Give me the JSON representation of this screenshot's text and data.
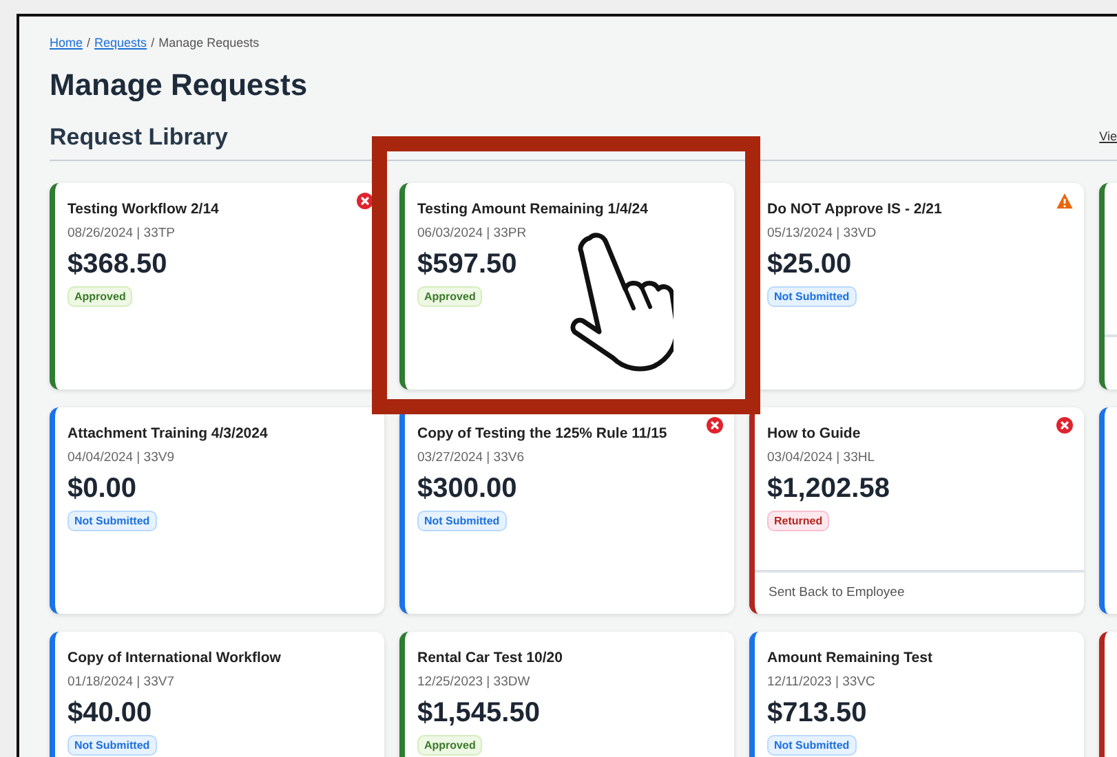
{
  "breadcrumb": {
    "separator": "/",
    "items": [
      {
        "label": "Home",
        "link": true
      },
      {
        "label": "Requests",
        "link": true
      },
      {
        "label": "Manage Requests",
        "link": false
      }
    ]
  },
  "title": "Manage Requests",
  "section": {
    "title": "Request Library",
    "action": "Vie"
  },
  "cards": [
    {
      "kind": "card",
      "title": "Testing Workflow 2/14",
      "meta": "08/26/2024 | 33TP",
      "amount": "$368.50",
      "status": {
        "label": "Approved",
        "kind": "approved"
      },
      "alert": {
        "kind": "error"
      }
    },
    {
      "kind": "card",
      "title": "Testing Amount Remaining 1/4/24",
      "meta": "06/03/2024 | 33PR",
      "amount": "$597.50",
      "status": {
        "label": "Approved",
        "kind": "approved"
      }
    },
    {
      "kind": "card",
      "title": "Do NOT Approve IS - 2/21",
      "meta": "05/13/2024 | 33VD",
      "amount": "$25.00",
      "status": {
        "label": "Not Submitted",
        "kind": "not_submitted"
      },
      "alert": {
        "kind": "warning"
      }
    },
    {
      "kind": "stub",
      "color": "#2e7d32",
      "footer": true
    },
    {
      "kind": "card",
      "title": "Attachment Training 4/3/2024",
      "meta": "04/04/2024 | 33V9",
      "amount": "$0.00",
      "status": {
        "label": "Not Submitted",
        "kind": "not_submitted"
      }
    },
    {
      "kind": "card",
      "title": "Copy of Testing the 125% Rule 11/15",
      "meta": "03/27/2024 | 33V6",
      "amount": "$300.00",
      "status": {
        "label": "Not Submitted",
        "kind": "not_submitted"
      },
      "alert": {
        "kind": "error"
      }
    },
    {
      "kind": "card",
      "title": "How to Guide",
      "meta": "03/04/2024 | 33HL",
      "amount": "$1,202.58",
      "status": {
        "label": "Returned",
        "kind": "returned"
      },
      "alert": {
        "kind": "error"
      },
      "footer": "Sent Back to Employee"
    },
    {
      "kind": "stub",
      "color": "#1a73e8"
    },
    {
      "kind": "card",
      "title": "Copy of International Workflow",
      "meta": "01/18/2024 | 33V7",
      "amount": "$40.00",
      "status": {
        "label": "Not Submitted",
        "kind": "not_submitted"
      }
    },
    {
      "kind": "card",
      "title": "Rental Car Test 10/20",
      "meta": "12/25/2023 | 33DW",
      "amount": "$1,545.50",
      "status": {
        "label": "Approved",
        "kind": "approved"
      }
    },
    {
      "kind": "card",
      "title": "Amount Remaining Test",
      "meta": "12/11/2023 | 33VC",
      "amount": "$713.50",
      "status": {
        "label": "Not Submitted",
        "kind": "not_submitted"
      }
    },
    {
      "kind": "stub",
      "color": "#b3261e"
    }
  ]
}
